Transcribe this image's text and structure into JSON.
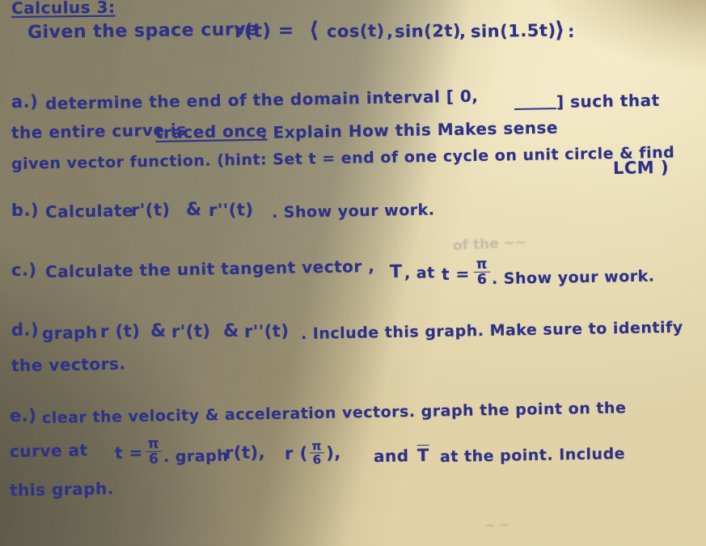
{
  "document": {
    "kind": "handwritten-assignment",
    "ink_color": "#2c3188",
    "paper_color": "#e6d7ae",
    "title": "Calculus 3:",
    "prompt_line": {
      "lead": "Given the space curve",
      "function_label": "r(t) =",
      "open_angle": "⟨",
      "component_1": "cos(t)",
      "comma_1": ",",
      "component_2": "sin(2t)",
      "comma_2": ",",
      "component_3": "sin(1.5t)",
      "close_angle": "⟩",
      "colon": ":"
    },
    "parts": {
      "a": {
        "label": "a.)",
        "l1_pre": "determine the end of the domain interval [ 0,",
        "l1_post": "] such that",
        "l2_pre": "the entire curve is",
        "l2_underlined": "traced once",
        "l2_post": ". Explain How this Makes sense",
        "l3_pre": "given vector function. (hint: Set  t = end of one  cycle on  unit circle & find",
        "l3_lcm": "LCM )"
      },
      "b": {
        "label": "b.)",
        "text_pre": "Calculate",
        "expr_1": "r'(t)",
        "amp": "&",
        "expr_2": "r''(t)",
        "text_post": ". Show your work."
      },
      "c": {
        "label": "c.)",
        "text_pre": "Calculate the  unit  tangent vector ,",
        "t_symbol": "T",
        "at": ", at",
        "t_equals": "t =",
        "frac_num": "π",
        "frac_den": "6",
        "text_post": ". Show your work."
      },
      "d": {
        "label": "d.)",
        "text_pre": "graph",
        "expr_1": "r (t)",
        "amp_1": "&",
        "expr_2": "r'(t)",
        "amp_2": "&",
        "expr_3": "r''(t)",
        "text_mid": ". Include this graph. Make sure to identify",
        "l2": "the  vectors."
      },
      "e": {
        "label": "e.)",
        "l1": "clear the velocity & acceleration vectors. graph the  point  on   the",
        "l2_pre": "curve at",
        "l2_t_equals": "t =",
        "l2_frac_num": "π",
        "l2_frac_den": "6",
        "l2_mid": ". graph",
        "l2_expr_1": "r(t),",
        "l2_expr_2_pre": "r (",
        "l2_expr_2_num": "π",
        "l2_expr_2_den": "6",
        "l2_expr_2_post": "),",
        "l2_post_and": "and",
        "l2_T": "T",
        "l2_tail": "at   the  point. Include",
        "l3": "this graph."
      }
    }
  }
}
